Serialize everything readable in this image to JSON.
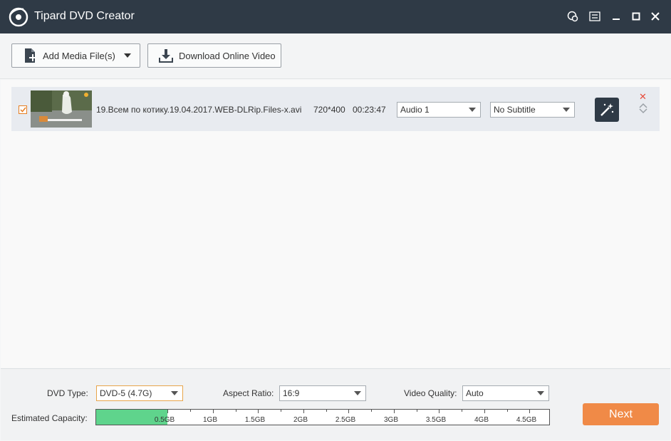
{
  "window": {
    "title": "Tipard DVD Creator",
    "controls": [
      "feedback-icon",
      "menu-icon",
      "minimize-icon",
      "maximize-icon",
      "close-icon"
    ]
  },
  "toolbar": {
    "add_media_label": "Add Media File(s)",
    "download_label": "Download Online Video"
  },
  "media_items": [
    {
      "checked": true,
      "file_name": "19.Всем по котику.19.04.2017.WEB-DLRip.Files-x.avi",
      "resolution": "720*400",
      "duration": "00:23:47",
      "audio": "Audio 1",
      "subtitle": "No Subtitle"
    }
  ],
  "settings": {
    "dvd_type_label": "DVD Type:",
    "dvd_type_value": "DVD-5 (4.7G)",
    "aspect_ratio_label": "Aspect Ratio:",
    "aspect_ratio_value": "16:9",
    "video_quality_label": "Video Quality:",
    "video_quality_value": "Auto"
  },
  "capacity": {
    "label": "Estimated Capacity:",
    "used_gb": 0.5,
    "max_gb": 5,
    "ticks": [
      "0.5GB",
      "1GB",
      "1.5GB",
      "2GB",
      "2.5GB",
      "3GB",
      "3.5GB",
      "4GB",
      "4.5GB"
    ]
  },
  "next_label": "Next",
  "colors": {
    "titlebar": "#2f3a46",
    "accent_orange": "#f08a47",
    "capacity_fill": "#5fd48c",
    "delete_red": "#e74c3c"
  }
}
